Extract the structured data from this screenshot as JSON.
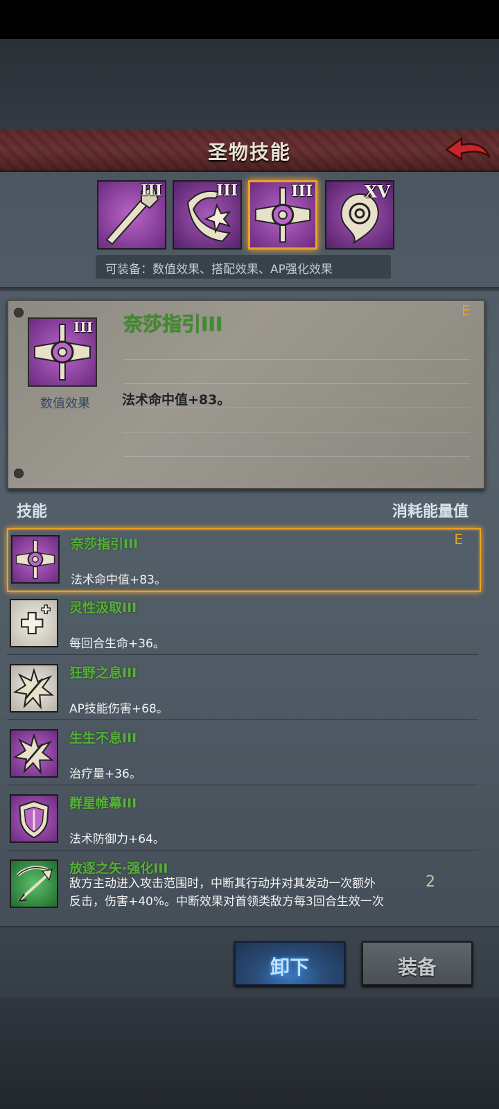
{
  "header": {
    "title": "圣物技能"
  },
  "relic_tabs": [
    {
      "icon": "staff-icon",
      "level": "III"
    },
    {
      "icon": "claw-slash-icon",
      "level": "III"
    },
    {
      "icon": "crosshair-cross-icon",
      "level": "III"
    },
    {
      "icon": "swirl-horn-icon",
      "level": "XV"
    }
  ],
  "equip_hint": "可装备：数值效果、搭配效果、AP强化效果",
  "detail": {
    "name": "奈莎指引III",
    "grade": "E",
    "level": "III",
    "category": "数值效果",
    "effect": "法术命中值+83。"
  },
  "list_header": {
    "left": "技能",
    "right": "消耗能量值"
  },
  "skills": [
    {
      "name": "奈莎指引III",
      "desc": "法术命中值+83。",
      "grade": "E",
      "icon": "crosshair-cross-icon"
    },
    {
      "name": "灵性汲取III",
      "desc": "每回合生命+36。",
      "icon": "health-plus-icon"
    },
    {
      "name": "狂野之息III",
      "desc": "AP技能伤害+68。",
      "icon": "burst-icon"
    },
    {
      "name": "生生不息III",
      "desc": "治疗量+36。",
      "icon": "heal-burst-icon"
    },
    {
      "name": "群星帷幕III",
      "desc": "法术防御力+64。",
      "icon": "shield-icon"
    },
    {
      "name": "放逐之矢·强化III",
      "desc_line1": "敌方主动进入攻击范围时，中断其行动并对其发动一次额外",
      "desc_line2": "反击，伤害+40%。中断效果对首领类敌方每3回合生效一次",
      "cost": "2",
      "icon": "bow-arrow-icon"
    }
  ],
  "buttons": {
    "unequip": "卸下",
    "equip": "装备"
  },
  "colors": {
    "accent": "#f0a020",
    "skill_name": "#57b03a",
    "header": "#6a3232"
  }
}
